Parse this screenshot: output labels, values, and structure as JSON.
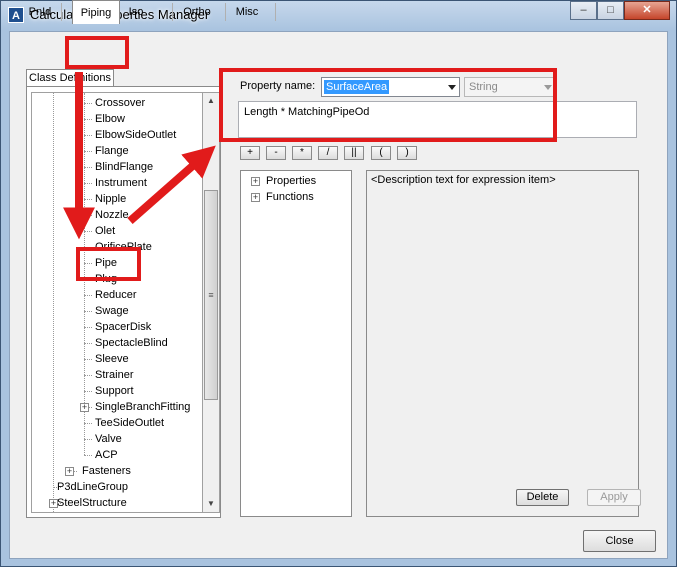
{
  "window": {
    "title": "Calculated Properties Manager",
    "icon_label": "A",
    "controls": {
      "minimize": "–",
      "maximize": "□",
      "close": "✕"
    }
  },
  "tabs": [
    "PnId",
    "Piping",
    "Iso",
    "Ortho",
    "Misc"
  ],
  "active_tab": "Piping",
  "subtab": "Class Definitions",
  "tree_items": [
    {
      "label": "Crossover",
      "level": 2
    },
    {
      "label": "Elbow",
      "level": 2
    },
    {
      "label": "ElbowSideOutlet",
      "level": 2
    },
    {
      "label": "Flange",
      "level": 2
    },
    {
      "label": "BlindFlange",
      "level": 2
    },
    {
      "label": "Instrument",
      "level": 2
    },
    {
      "label": "Nipple",
      "level": 2
    },
    {
      "label": "Nozzle",
      "level": 2
    },
    {
      "label": "Olet",
      "level": 2
    },
    {
      "label": "OrificePlate",
      "level": 2
    },
    {
      "label": "Pipe",
      "level": 2
    },
    {
      "label": "Plug",
      "level": 2
    },
    {
      "label": "Reducer",
      "level": 2
    },
    {
      "label": "Swage",
      "level": 2
    },
    {
      "label": "SpacerDisk",
      "level": 2
    },
    {
      "label": "SpectacleBlind",
      "level": 2
    },
    {
      "label": "Sleeve",
      "level": 2
    },
    {
      "label": "Strainer",
      "level": 2
    },
    {
      "label": "Support",
      "level": 2
    },
    {
      "label": "SingleBranchFitting",
      "level": 2,
      "expandable": true
    },
    {
      "label": "TeeSideOutlet",
      "level": 2
    },
    {
      "label": "Valve",
      "level": 2
    },
    {
      "label": "ACP",
      "level": 2
    },
    {
      "label": "Fasteners",
      "level": 1,
      "expandable": true
    },
    {
      "label": "P3dLineGroup",
      "level": 0
    },
    {
      "label": "SteelStructure",
      "level": 0,
      "expandable": true
    }
  ],
  "property_name_label": "Property name:",
  "property_name_value": "SurfaceArea",
  "property_type": "String",
  "expression": "Length * MatchingPipeOd",
  "operators": [
    "+",
    "-",
    "*",
    "/",
    "||",
    "(",
    ")"
  ],
  "expression_tree": [
    {
      "label": "Properties",
      "expand": "+"
    },
    {
      "label": "Functions",
      "expand": "+"
    }
  ],
  "description_text": "<Description text for expression item>",
  "buttons": {
    "delete": "Delete",
    "apply": "Apply",
    "close": "Close"
  },
  "colors": {
    "highlight": "#e11b1b",
    "selection": "#3399ff"
  }
}
